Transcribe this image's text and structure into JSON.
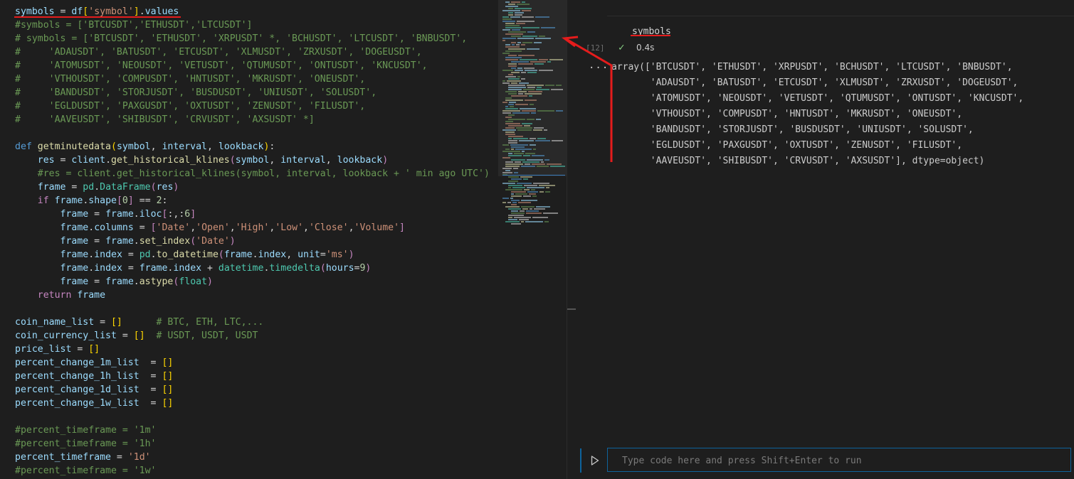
{
  "editor": {
    "lines": [
      [
        [
          "v",
          "symbols"
        ],
        [
          "d",
          " = "
        ],
        [
          "v",
          "df"
        ],
        [
          "b",
          "["
        ],
        [
          "s",
          "'symbol'"
        ],
        [
          "b",
          "]"
        ],
        [
          "d",
          "."
        ],
        [
          "v",
          "values"
        ]
      ],
      [
        [
          "c",
          "#symbols = ['BTCUSDT','ETHUSDT','LTCUSDT']"
        ]
      ],
      [
        [
          "c",
          "# symbols = ['BTCUSDT', 'ETHUSDT', 'XRPUSDT' *, 'BCHUSDT', 'LTCUSDT', 'BNBUSDT',"
        ]
      ],
      [
        [
          "c",
          "#     'ADAUSDT', 'BATUSDT', 'ETCUSDT', 'XLMUSDT', 'ZRXUSDT', 'DOGEUSDT',"
        ]
      ],
      [
        [
          "c",
          "#     'ATOMUSDT', 'NEOUSDT', 'VETUSDT', 'QTUMUSDT', 'ONTUSDT', 'KNCUSDT',"
        ]
      ],
      [
        [
          "c",
          "#     'VTHOUSDT', 'COMPUSDT', 'HNTUSDT', 'MKRUSDT', 'ONEUSDT',"
        ]
      ],
      [
        [
          "c",
          "#     'BANDUSDT', 'STORJUSDT', 'BUSDUSDT', 'UNIUSDT', 'SOLUSDT',"
        ]
      ],
      [
        [
          "c",
          "#     'EGLDUSDT', 'PAXGUSDT', 'OXTUSDT', 'ZENUSDT', 'FILUSDT',"
        ]
      ],
      [
        [
          "c",
          "#     'AAVEUSDT', 'SHIBUSDT', 'CRVUSDT', 'AXSUSDT' *]"
        ]
      ],
      [],
      [
        [
          "k",
          "def"
        ],
        [
          "d",
          " "
        ],
        [
          "f",
          "getminutedata"
        ],
        [
          "b",
          "("
        ],
        [
          "v",
          "symbol"
        ],
        [
          "d",
          ", "
        ],
        [
          "v",
          "interval"
        ],
        [
          "d",
          ", "
        ],
        [
          "v",
          "lookback"
        ],
        [
          "b",
          ")"
        ],
        [
          "d",
          ":"
        ]
      ],
      [
        [
          "d",
          "    "
        ],
        [
          "v",
          "res"
        ],
        [
          "d",
          " = "
        ],
        [
          "v",
          "client"
        ],
        [
          "d",
          "."
        ],
        [
          "f",
          "get_historical_klines"
        ],
        [
          "m",
          "("
        ],
        [
          "v",
          "symbol"
        ],
        [
          "d",
          ", "
        ],
        [
          "v",
          "interval"
        ],
        [
          "d",
          ", "
        ],
        [
          "v",
          "lookback"
        ],
        [
          "m",
          ")"
        ]
      ],
      [
        [
          "d",
          "    "
        ],
        [
          "c",
          "#res = client.get_historical_klines(symbol, interval, lookback + ' min ago UTC')"
        ]
      ],
      [
        [
          "d",
          "    "
        ],
        [
          "v",
          "frame"
        ],
        [
          "d",
          " = "
        ],
        [
          "t",
          "pd"
        ],
        [
          "d",
          "."
        ],
        [
          "t",
          "DataFrame"
        ],
        [
          "m",
          "("
        ],
        [
          "v",
          "res"
        ],
        [
          "m",
          ")"
        ]
      ],
      [
        [
          "d",
          "    "
        ],
        [
          "m",
          "if"
        ],
        [
          "d",
          " "
        ],
        [
          "v",
          "frame"
        ],
        [
          "d",
          "."
        ],
        [
          "v",
          "shape"
        ],
        [
          "m",
          "["
        ],
        [
          "n",
          "0"
        ],
        [
          "m",
          "]"
        ],
        [
          "d",
          " == "
        ],
        [
          "n",
          "2"
        ],
        [
          "d",
          ":"
        ]
      ],
      [
        [
          "d",
          "        "
        ],
        [
          "v",
          "frame"
        ],
        [
          "d",
          " = "
        ],
        [
          "v",
          "frame"
        ],
        [
          "d",
          "."
        ],
        [
          "v",
          "iloc"
        ],
        [
          "m",
          "["
        ],
        [
          "d",
          ":,:"
        ],
        [
          "n",
          "6"
        ],
        [
          "m",
          "]"
        ]
      ],
      [
        [
          "d",
          "        "
        ],
        [
          "v",
          "frame"
        ],
        [
          "d",
          "."
        ],
        [
          "v",
          "columns"
        ],
        [
          "d",
          " = "
        ],
        [
          "m",
          "["
        ],
        [
          "s",
          "'Date'"
        ],
        [
          "d",
          ","
        ],
        [
          "s",
          "'Open'"
        ],
        [
          "d",
          ","
        ],
        [
          "s",
          "'High'"
        ],
        [
          "d",
          ","
        ],
        [
          "s",
          "'Low'"
        ],
        [
          "d",
          ","
        ],
        [
          "s",
          "'Close'"
        ],
        [
          "d",
          ","
        ],
        [
          "s",
          "'Volume'"
        ],
        [
          "m",
          "]"
        ]
      ],
      [
        [
          "d",
          "        "
        ],
        [
          "v",
          "frame"
        ],
        [
          "d",
          " = "
        ],
        [
          "v",
          "frame"
        ],
        [
          "d",
          "."
        ],
        [
          "f",
          "set_index"
        ],
        [
          "m",
          "("
        ],
        [
          "s",
          "'Date'"
        ],
        [
          "m",
          ")"
        ]
      ],
      [
        [
          "d",
          "        "
        ],
        [
          "v",
          "frame"
        ],
        [
          "d",
          "."
        ],
        [
          "v",
          "index"
        ],
        [
          "d",
          " = "
        ],
        [
          "t",
          "pd"
        ],
        [
          "d",
          "."
        ],
        [
          "f",
          "to_datetime"
        ],
        [
          "m",
          "("
        ],
        [
          "v",
          "frame"
        ],
        [
          "d",
          "."
        ],
        [
          "v",
          "index"
        ],
        [
          "d",
          ", "
        ],
        [
          "v",
          "unit"
        ],
        [
          "d",
          "="
        ],
        [
          "s",
          "'ms'"
        ],
        [
          "m",
          ")"
        ]
      ],
      [
        [
          "d",
          "        "
        ],
        [
          "v",
          "frame"
        ],
        [
          "d",
          "."
        ],
        [
          "v",
          "index"
        ],
        [
          "d",
          " = "
        ],
        [
          "v",
          "frame"
        ],
        [
          "d",
          "."
        ],
        [
          "v",
          "index"
        ],
        [
          "d",
          " + "
        ],
        [
          "t",
          "datetime"
        ],
        [
          "d",
          "."
        ],
        [
          "t",
          "timedelta"
        ],
        [
          "m",
          "("
        ],
        [
          "v",
          "hours"
        ],
        [
          "d",
          "="
        ],
        [
          "n",
          "9"
        ],
        [
          "m",
          ")"
        ]
      ],
      [
        [
          "d",
          "        "
        ],
        [
          "v",
          "frame"
        ],
        [
          "d",
          " = "
        ],
        [
          "v",
          "frame"
        ],
        [
          "d",
          "."
        ],
        [
          "f",
          "astype"
        ],
        [
          "m",
          "("
        ],
        [
          "t",
          "float"
        ],
        [
          "m",
          ")"
        ]
      ],
      [
        [
          "d",
          "    "
        ],
        [
          "m",
          "return"
        ],
        [
          "d",
          " "
        ],
        [
          "v",
          "frame"
        ]
      ],
      [],
      [
        [
          "v",
          "coin_name_list"
        ],
        [
          "d",
          " = "
        ],
        [
          "b",
          "[]"
        ],
        [
          "d",
          "      "
        ],
        [
          "c",
          "# BTC, ETH, LTC,..."
        ]
      ],
      [
        [
          "v",
          "coin_currency_list"
        ],
        [
          "d",
          " = "
        ],
        [
          "b",
          "[]"
        ],
        [
          "d",
          "  "
        ],
        [
          "c",
          "# USDT, USDT, USDT"
        ]
      ],
      [
        [
          "v",
          "price_list"
        ],
        [
          "d",
          " = "
        ],
        [
          "b",
          "[]"
        ]
      ],
      [
        [
          "v",
          "percent_change_1m_list"
        ],
        [
          "d",
          "  = "
        ],
        [
          "b",
          "[]"
        ]
      ],
      [
        [
          "v",
          "percent_change_1h_list"
        ],
        [
          "d",
          "  = "
        ],
        [
          "b",
          "[]"
        ]
      ],
      [
        [
          "v",
          "percent_change_1d_list"
        ],
        [
          "d",
          "  = "
        ],
        [
          "b",
          "[]"
        ]
      ],
      [
        [
          "v",
          "percent_change_1w_list"
        ],
        [
          "d",
          "  = "
        ],
        [
          "b",
          "[]"
        ]
      ],
      [],
      [
        [
          "c",
          "#percent_timeframe = '1m'"
        ]
      ],
      [
        [
          "c",
          "#percent_timeframe = '1h'"
        ]
      ],
      [
        [
          "v",
          "percent_timeframe"
        ],
        [
          "d",
          " = "
        ],
        [
          "s",
          "'1d'"
        ]
      ],
      [
        [
          "c",
          "#percent_timeframe = '1w'"
        ]
      ]
    ]
  },
  "notebook": {
    "cell_code": "symbols",
    "exec_count": "[12]",
    "status_time": "0.4s",
    "output_more": "...",
    "output_lines": [
      "array(['BTCUSDT', 'ETHUSDT', 'XRPUSDT', 'BCHUSDT', 'LTCUSDT', 'BNBUSDT',",
      "       'ADAUSDT', 'BATUSDT', 'ETCUSDT', 'XLMUSDT', 'ZRXUSDT', 'DOGEUSDT',",
      "       'ATOMUSDT', 'NEOUSDT', 'VETUSDT', 'QTUMUSDT', 'ONTUSDT', 'KNCUSDT',",
      "       'VTHOUSDT', 'COMPUSDT', 'HNTUSDT', 'MKRUSDT', 'ONEUSDT',",
      "       'BANDUSDT', 'STORJUSDT', 'BUSDUSDT', 'UNIUSDT', 'SOLUSDT',",
      "       'EGLDUSDT', 'PAXGUSDT', 'OXTUSDT', 'ZENUSDT', 'FILUSDT',",
      "       'AAVEUSDT', 'SHIBUSDT', 'CRVUSDT', 'AXSUSDT'], dtype=object)"
    ],
    "input_placeholder": "Type code here and press Shift+Enter to run"
  },
  "icons": {
    "check": "check-icon",
    "run": "play-icon",
    "more": "more-icon"
  },
  "colors": {
    "background": "#1e1e1e",
    "accent": "#0e639c",
    "annotation": "#e51c1c",
    "success": "#89d185"
  }
}
